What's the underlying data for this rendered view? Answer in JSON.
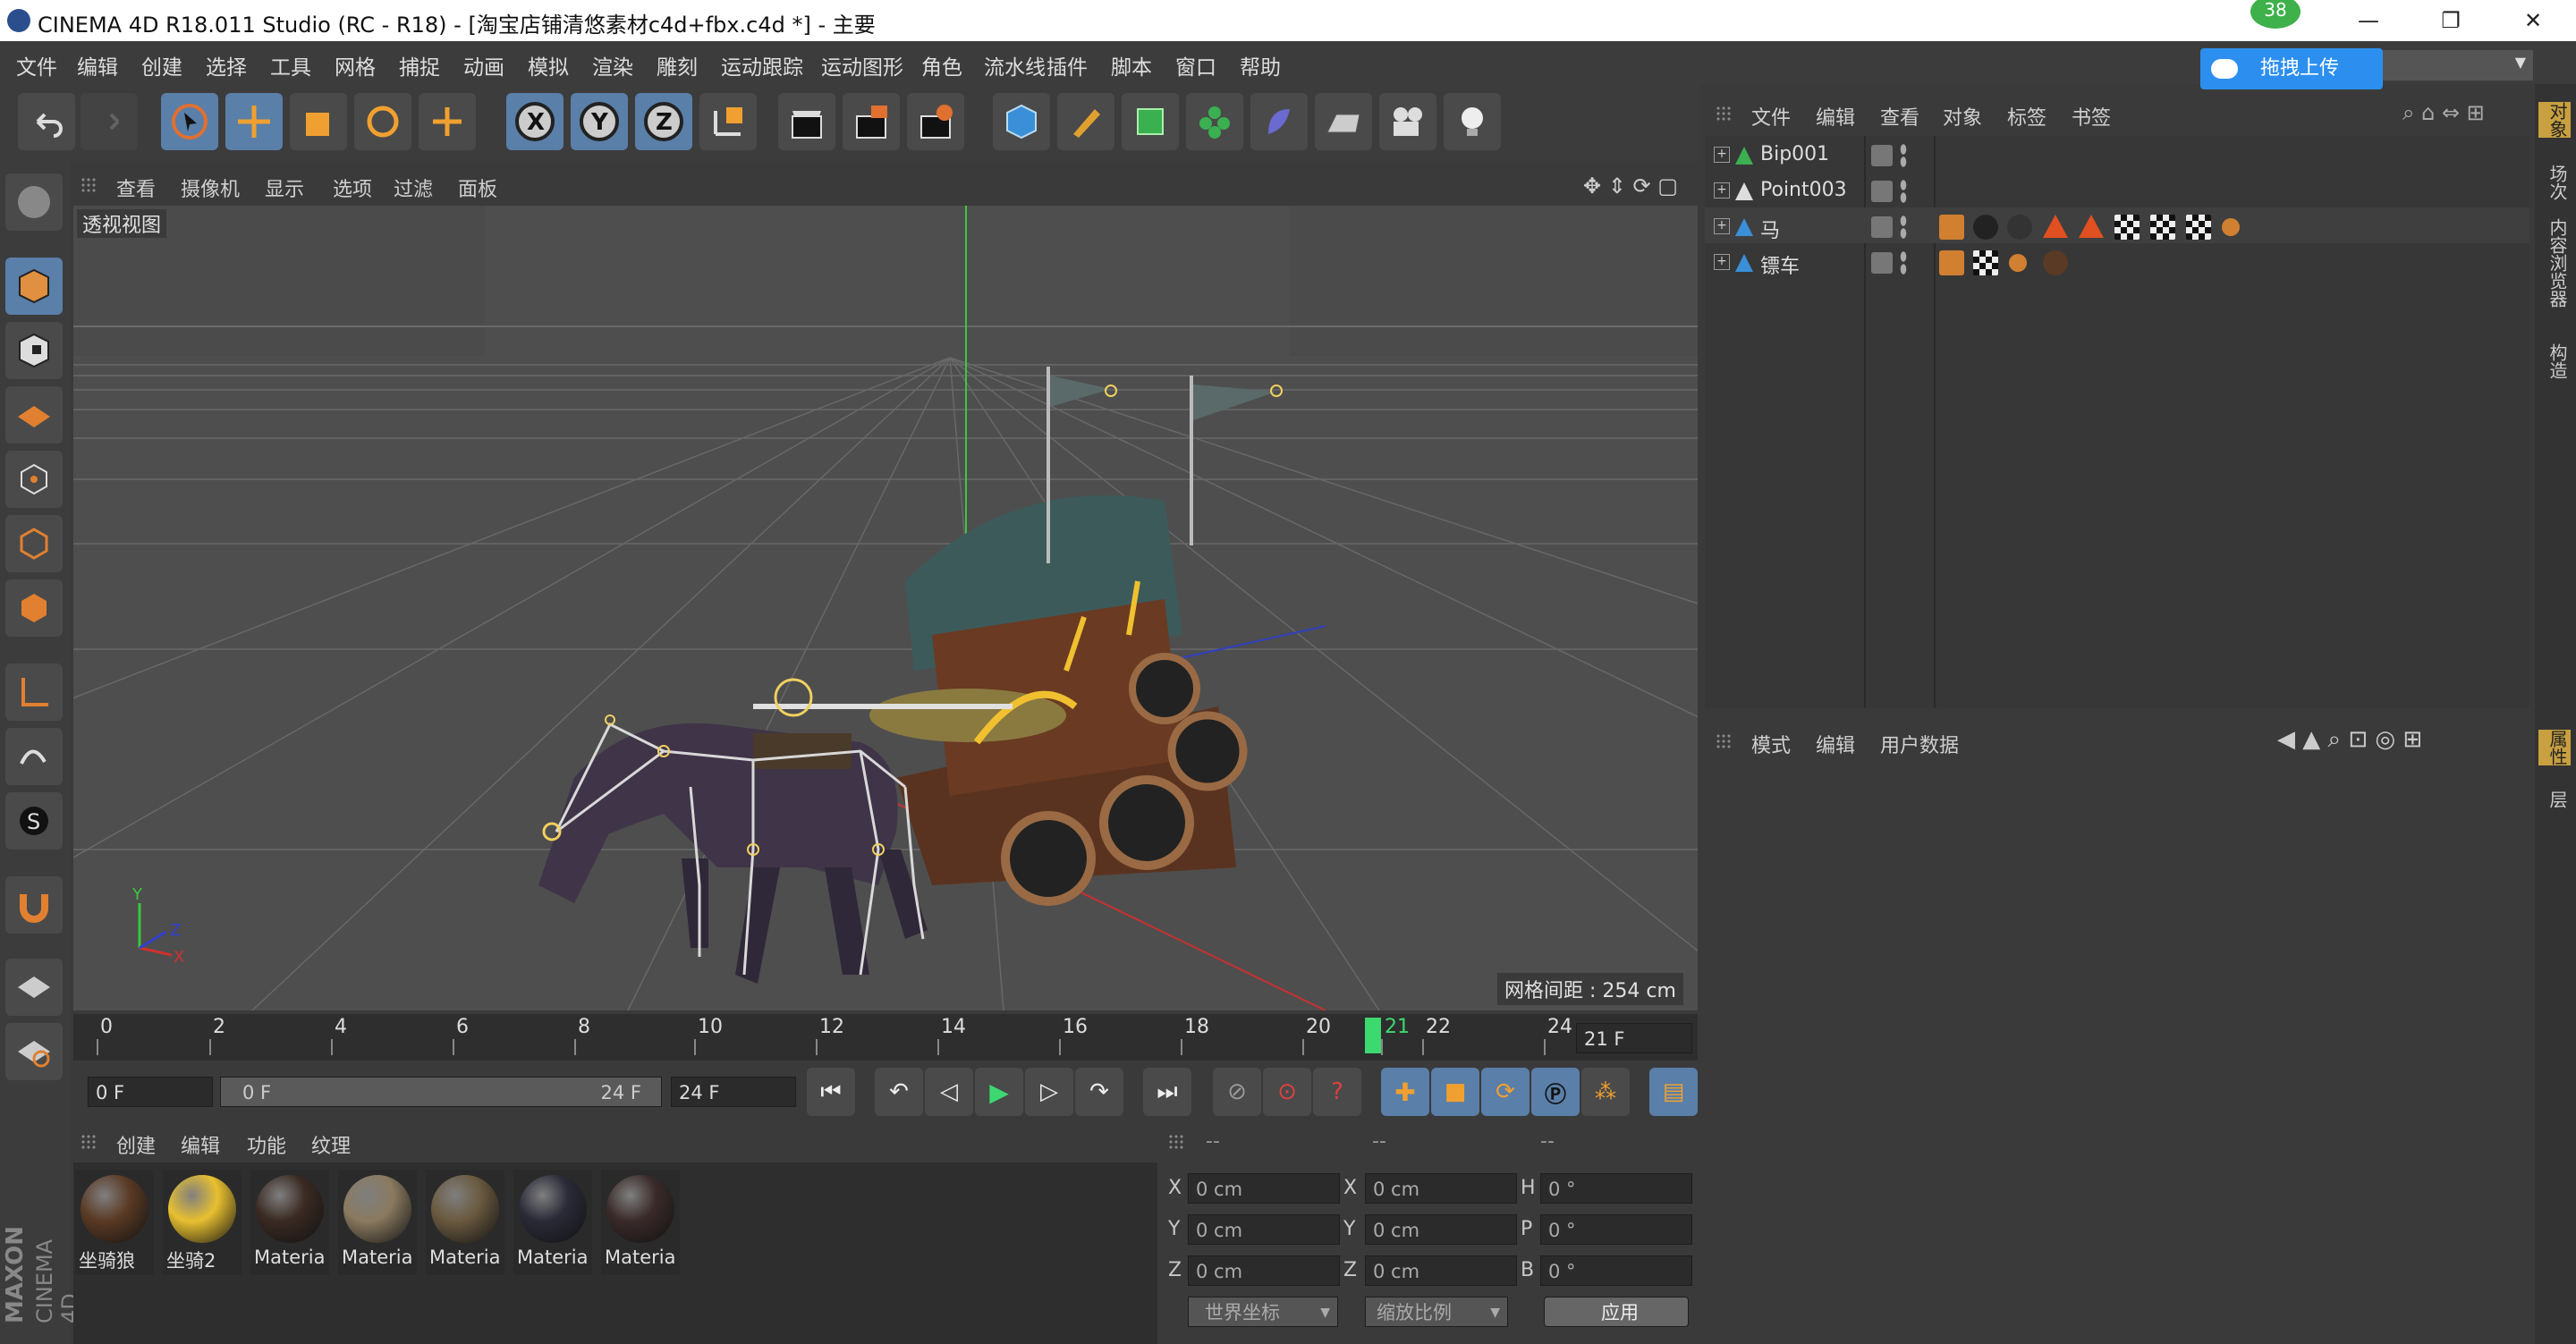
{
  "window": {
    "title": "CINEMA 4D R18.011 Studio (RC - R18) - [淘宝店铺清悠素材c4d+fbx.c4d *] - 主要",
    "badge": "38",
    "upload_label": "拖拽上传"
  },
  "menu": [
    "文件",
    "编辑",
    "创建",
    "选择",
    "工具",
    "网格",
    "捕捉",
    "动画",
    "模拟",
    "渲染",
    "雕刻",
    "运动跟踪",
    "运动图形",
    "角色",
    "流水线",
    "插件",
    "脚本",
    "窗口",
    "帮助"
  ],
  "viewport": {
    "menu": [
      "查看",
      "摄像机",
      "显示",
      "选项",
      "过滤",
      "面板"
    ],
    "name": "透视视图",
    "grid_info": "网格间距 : 254 cm"
  },
  "timeline": {
    "ticks": [
      "0",
      "2",
      "4",
      "6",
      "8",
      "10",
      "12",
      "14",
      "16",
      "18",
      "20",
      "21",
      "22",
      "24"
    ],
    "current_frame": "21 F",
    "start_field": "0 F",
    "range_start": "0 F",
    "range_end": "24 F",
    "end_field": "24 F"
  },
  "materials": {
    "menu": [
      "创建",
      "编辑",
      "功能",
      "纹理"
    ],
    "items": [
      {
        "label": "坐骑狼",
        "color": "#5a3a24"
      },
      {
        "label": "坐骑2",
        "color": "#e8c030"
      },
      {
        "label": "Materia",
        "color": "#3a2a22"
      },
      {
        "label": "Materia",
        "color": "#8a7a60"
      },
      {
        "label": "Materia",
        "color": "#6a5a40"
      },
      {
        "label": "Materia",
        "color": "#2a2a38"
      },
      {
        "label": "Materia",
        "color": "#3a2a2a"
      }
    ]
  },
  "coords": {
    "headers": [
      "--",
      "--",
      "--"
    ],
    "rows": [
      {
        "a": "X",
        "av": "0 cm",
        "b": "X",
        "bv": "0 cm",
        "c": "H",
        "cv": "0 °"
      },
      {
        "a": "Y",
        "av": "0 cm",
        "b": "Y",
        "bv": "0 cm",
        "c": "P",
        "cv": "0 °"
      },
      {
        "a": "Z",
        "av": "0 cm",
        "b": "Z",
        "bv": "0 cm",
        "c": "B",
        "cv": "0 °"
      }
    ],
    "world_label": "世界坐标",
    "scale_label": "缩放比例",
    "apply_label": "应用"
  },
  "objects": {
    "menu": [
      "文件",
      "编辑",
      "查看",
      "对象",
      "标签",
      "书签"
    ],
    "items": [
      {
        "name": "Bip001"
      },
      {
        "name": "Point003"
      },
      {
        "name": "马"
      },
      {
        "name": "镖车"
      }
    ]
  },
  "attributes": {
    "menu": [
      "模式",
      "编辑",
      "用户数据"
    ]
  },
  "side_tabs": [
    "对象",
    "场次",
    "内容浏览器",
    "构造"
  ],
  "side_tabs_lower": [
    "属性",
    "层"
  ],
  "brand": {
    "maxon": "MAXON",
    "c4d": "CINEMA 4D"
  },
  "accent": "#5a7fa8"
}
